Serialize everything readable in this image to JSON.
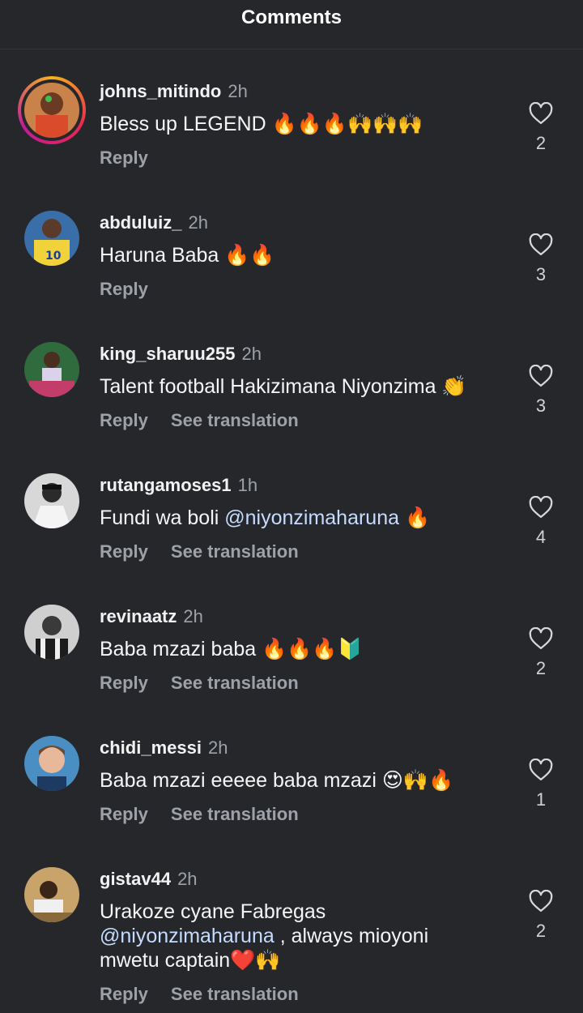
{
  "header": {
    "title": "Comments"
  },
  "comments": [
    {
      "username": "johns_mitindo",
      "time": "2h",
      "text": "Bless up LEGEND 🔥🔥🔥🙌🙌🙌",
      "reply": "Reply",
      "translate": "",
      "likes": "2"
    },
    {
      "username": "abduluiz_",
      "time": "2h",
      "text": "Haruna Baba 🔥🔥",
      "reply": "Reply",
      "translate": "",
      "likes": "3"
    },
    {
      "username": "king_sharuu255",
      "time": "2h",
      "text": "Talent football Hakizimana Niyonzima 👏",
      "reply": "Reply",
      "translate": "See translation",
      "likes": "3"
    },
    {
      "username": "rutangamoses1",
      "time": "1h",
      "text_before": "Fundi wa boli ",
      "mention": "@niyonzimaharuna",
      "text_after": " 🔥",
      "reply": "Reply",
      "translate": "See translation",
      "likes": "4"
    },
    {
      "username": "revinaatz",
      "time": "2h",
      "text": "Baba mzazi baba 🔥🔥🔥🔰",
      "reply": "Reply",
      "translate": "See translation",
      "likes": "2"
    },
    {
      "username": "chidi_messi",
      "time": "2h",
      "text": "Baba mzazi eeeee baba mzazi 😍🙌🔥",
      "reply": "Reply",
      "translate": "See translation",
      "likes": "1"
    },
    {
      "username": "gistav44",
      "time": "2h",
      "text_before": "Urakoze cyane Fabregas ",
      "mention": "@niyonzimaharuna",
      "text_after": " , always mioyoni mwetu captain❤️🙌",
      "reply": "Reply",
      "translate": "See translation",
      "likes": "2"
    }
  ]
}
